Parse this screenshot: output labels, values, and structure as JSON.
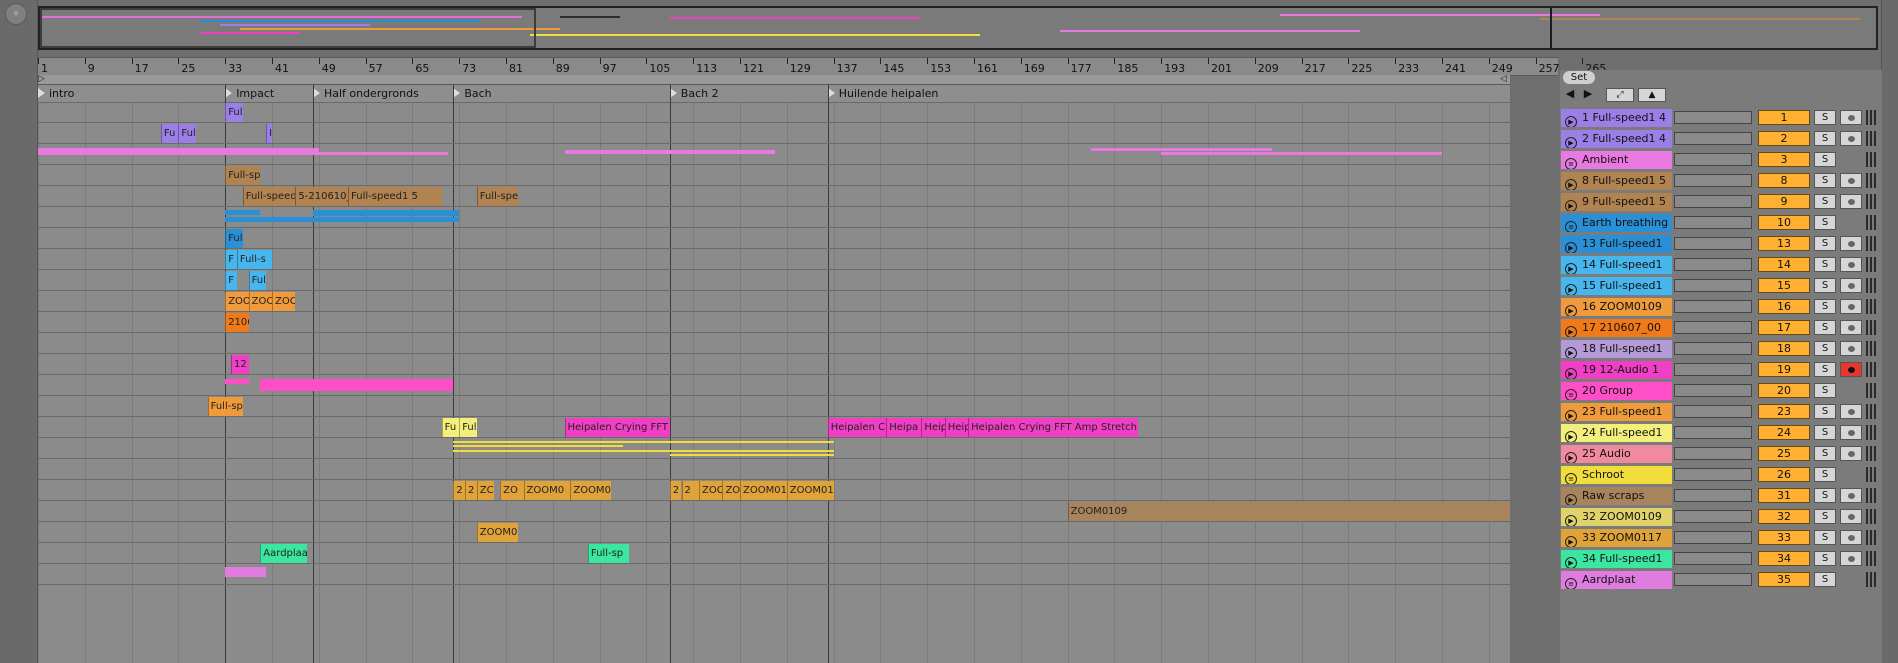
{
  "ruler": {
    "ticks": [
      "1",
      "9",
      "17",
      "25",
      "33",
      "41",
      "49",
      "57",
      "65",
      "73",
      "81",
      "89",
      "97",
      "105",
      "113",
      "121",
      "129",
      "137",
      "145",
      "153",
      "161",
      "169",
      "177",
      "185",
      "193",
      "201",
      "209",
      "217",
      "225",
      "233",
      "241",
      "249",
      "257",
      "265"
    ]
  },
  "locators": [
    {
      "label": "intro"
    },
    {
      "label": "Impact"
    },
    {
      "label": "Half ondergronds"
    },
    {
      "label": "Bach"
    },
    {
      "label": "Bach 2"
    },
    {
      "label": "Huilende heipalen"
    }
  ],
  "toolbar": {
    "set_label": "Set",
    "back_icon": "arrow-left-icon",
    "forward_icon": "arrow-right-icon",
    "expand_icon": "expand-icon",
    "lock_icon": "lock-icon"
  },
  "colors": {
    "purple": "#9b7fe6",
    "pink": "#e879e0",
    "brown": "#b08350",
    "blue": "#2a8fd4",
    "lightblue": "#47b6ec",
    "orange": "#ef9a3b",
    "darkorange": "#f07a1a",
    "lavender": "#b49ad6",
    "magenta": "#f03fc4",
    "hotpink": "#ff4fc8",
    "yellow": "#f3ef7a",
    "salmon": "#f08aa0",
    "gold": "#f0dc3a",
    "rawscraps": "#a8845c",
    "olive": "#e0d36a",
    "amber": "#e0a33a",
    "green": "#3be6a0",
    "violet": "#e07be0",
    "record_on": "#e8362f"
  },
  "tracks": [
    {
      "name": "1 Full-speed1 4",
      "num": "1",
      "color": "purple",
      "icon": "play",
      "rec": "off"
    },
    {
      "name": "2 Full-speed1 4",
      "num": "2",
      "color": "purple",
      "icon": "play",
      "rec": "off"
    },
    {
      "name": "Ambient",
      "num": "3",
      "color": "pink",
      "icon": "group",
      "rec": "none"
    },
    {
      "name": "8 Full-speed1 5",
      "num": "8",
      "color": "brown",
      "icon": "play",
      "rec": "off"
    },
    {
      "name": "9 Full-speed1 5",
      "num": "9",
      "color": "brown",
      "icon": "play",
      "rec": "off"
    },
    {
      "name": "Earth breathing",
      "num": "10",
      "color": "blue",
      "icon": "group",
      "rec": "none"
    },
    {
      "name": "13 Full-speed1",
      "num": "13",
      "color": "blue",
      "icon": "play",
      "rec": "off"
    },
    {
      "name": "14 Full-speed1",
      "num": "14",
      "color": "lightblue",
      "icon": "play",
      "rec": "off"
    },
    {
      "name": "15 Full-speed1",
      "num": "15",
      "color": "lightblue",
      "icon": "play",
      "rec": "off"
    },
    {
      "name": "16 ZOOM0109",
      "num": "16",
      "color": "orange",
      "icon": "play",
      "rec": "off"
    },
    {
      "name": "17 210607_00",
      "num": "17",
      "color": "darkorange",
      "icon": "play",
      "rec": "off"
    },
    {
      "name": "18 Full-speed1",
      "num": "18",
      "color": "lavender",
      "icon": "play",
      "rec": "off"
    },
    {
      "name": "19 12-Audio 1",
      "num": "19",
      "color": "magenta",
      "icon": "play",
      "rec": "on"
    },
    {
      "name": "20 Group",
      "num": "20",
      "color": "hotpink",
      "icon": "group",
      "rec": "none"
    },
    {
      "name": "23 Full-speed1",
      "num": "23",
      "color": "orange",
      "icon": "play",
      "rec": "off"
    },
    {
      "name": "24 Full-speed1",
      "num": "24",
      "color": "yellow",
      "icon": "play",
      "rec": "off"
    },
    {
      "name": "25 Audio",
      "num": "25",
      "color": "salmon",
      "icon": "play",
      "rec": "off"
    },
    {
      "name": "Schroot",
      "num": "26",
      "color": "gold",
      "icon": "group",
      "rec": "none"
    },
    {
      "name": "Raw scraps",
      "num": "31",
      "color": "rawscraps",
      "icon": "play",
      "rec": "off"
    },
    {
      "name": "32 ZOOM0109",
      "num": "32",
      "color": "olive",
      "icon": "play",
      "rec": "off"
    },
    {
      "name": "33 ZOOM0117",
      "num": "33",
      "color": "amber",
      "icon": "play",
      "rec": "off"
    },
    {
      "name": "34 Full-speed1",
      "num": "34",
      "color": "green",
      "icon": "play",
      "rec": "off"
    },
    {
      "name": "Aardplaat",
      "num": "35",
      "color": "violet",
      "icon": "group",
      "rec": "none"
    }
  ],
  "solo_label": "S",
  "clips": [
    {
      "label": "Ful"
    },
    {
      "label": "Fu"
    },
    {
      "label": "Ful"
    },
    {
      "label": "I"
    },
    {
      "label": "Full-spe"
    },
    {
      "label": "Full-speed1"
    },
    {
      "label": "5-210610_00"
    },
    {
      "label": "Full-speed1 5"
    },
    {
      "label": "Full-spee"
    },
    {
      "label": "Ful"
    },
    {
      "label": "F"
    },
    {
      "label": "Full-s"
    },
    {
      "label": "F"
    },
    {
      "label": "Ful"
    },
    {
      "label": "ZOO"
    },
    {
      "label": "ZOO"
    },
    {
      "label": "ZOO"
    },
    {
      "label": "2106"
    },
    {
      "label": "12"
    },
    {
      "label": "Full-sp"
    },
    {
      "label": "Fu"
    },
    {
      "label": "Full"
    },
    {
      "label": "Heipalen Crying FFT"
    },
    {
      "label": "Heipalen C"
    },
    {
      "label": "Heipa"
    },
    {
      "label": "Heip"
    },
    {
      "label": "Heip"
    },
    {
      "label": "Heipalen Crying FFT Amp Stretch"
    },
    {
      "label": "2"
    },
    {
      "label": "2"
    },
    {
      "label": "ZC"
    },
    {
      "label": "ZO"
    },
    {
      "label": "ZOOM0"
    },
    {
      "label": "ZOOM0"
    },
    {
      "label": "2"
    },
    {
      "label": "2"
    },
    {
      "label": "ZOC"
    },
    {
      "label": "ZO("
    },
    {
      "label": "ZOOM01"
    },
    {
      "label": "ZOOM01"
    },
    {
      "label": "ZOOM0109"
    },
    {
      "label": "ZOOM0"
    },
    {
      "label": "Aardplaa"
    },
    {
      "label": "Full-sp"
    }
  ]
}
